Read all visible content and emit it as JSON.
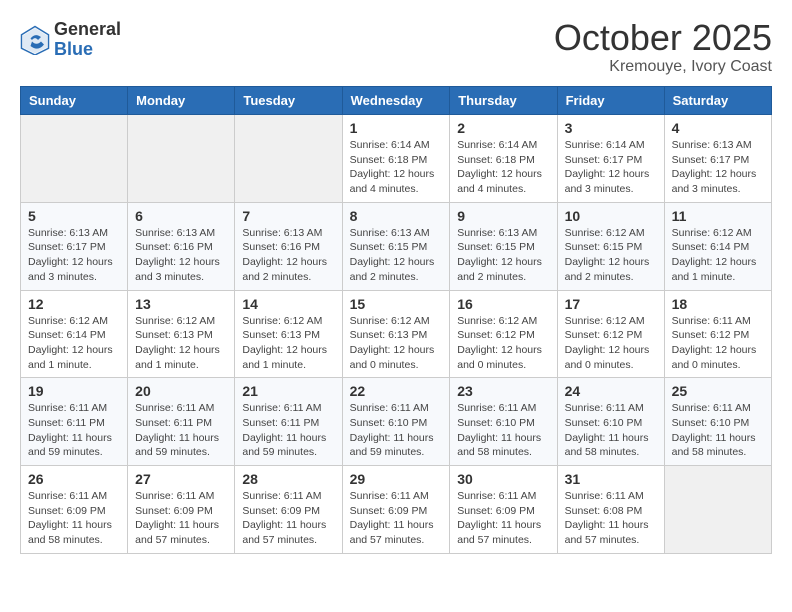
{
  "header": {
    "logo_general": "General",
    "logo_blue": "Blue",
    "month": "October 2025",
    "location": "Kremouye, Ivory Coast"
  },
  "days_of_week": [
    "Sunday",
    "Monday",
    "Tuesday",
    "Wednesday",
    "Thursday",
    "Friday",
    "Saturday"
  ],
  "weeks": [
    [
      {
        "day": "",
        "info": ""
      },
      {
        "day": "",
        "info": ""
      },
      {
        "day": "",
        "info": ""
      },
      {
        "day": "1",
        "info": "Sunrise: 6:14 AM\nSunset: 6:18 PM\nDaylight: 12 hours\nand 4 minutes."
      },
      {
        "day": "2",
        "info": "Sunrise: 6:14 AM\nSunset: 6:18 PM\nDaylight: 12 hours\nand 4 minutes."
      },
      {
        "day": "3",
        "info": "Sunrise: 6:14 AM\nSunset: 6:17 PM\nDaylight: 12 hours\nand 3 minutes."
      },
      {
        "day": "4",
        "info": "Sunrise: 6:13 AM\nSunset: 6:17 PM\nDaylight: 12 hours\nand 3 minutes."
      }
    ],
    [
      {
        "day": "5",
        "info": "Sunrise: 6:13 AM\nSunset: 6:17 PM\nDaylight: 12 hours\nand 3 minutes."
      },
      {
        "day": "6",
        "info": "Sunrise: 6:13 AM\nSunset: 6:16 PM\nDaylight: 12 hours\nand 3 minutes."
      },
      {
        "day": "7",
        "info": "Sunrise: 6:13 AM\nSunset: 6:16 PM\nDaylight: 12 hours\nand 2 minutes."
      },
      {
        "day": "8",
        "info": "Sunrise: 6:13 AM\nSunset: 6:15 PM\nDaylight: 12 hours\nand 2 minutes."
      },
      {
        "day": "9",
        "info": "Sunrise: 6:13 AM\nSunset: 6:15 PM\nDaylight: 12 hours\nand 2 minutes."
      },
      {
        "day": "10",
        "info": "Sunrise: 6:12 AM\nSunset: 6:15 PM\nDaylight: 12 hours\nand 2 minutes."
      },
      {
        "day": "11",
        "info": "Sunrise: 6:12 AM\nSunset: 6:14 PM\nDaylight: 12 hours\nand 1 minute."
      }
    ],
    [
      {
        "day": "12",
        "info": "Sunrise: 6:12 AM\nSunset: 6:14 PM\nDaylight: 12 hours\nand 1 minute."
      },
      {
        "day": "13",
        "info": "Sunrise: 6:12 AM\nSunset: 6:13 PM\nDaylight: 12 hours\nand 1 minute."
      },
      {
        "day": "14",
        "info": "Sunrise: 6:12 AM\nSunset: 6:13 PM\nDaylight: 12 hours\nand 1 minute."
      },
      {
        "day": "15",
        "info": "Sunrise: 6:12 AM\nSunset: 6:13 PM\nDaylight: 12 hours\nand 0 minutes."
      },
      {
        "day": "16",
        "info": "Sunrise: 6:12 AM\nSunset: 6:12 PM\nDaylight: 12 hours\nand 0 minutes."
      },
      {
        "day": "17",
        "info": "Sunrise: 6:12 AM\nSunset: 6:12 PM\nDaylight: 12 hours\nand 0 minutes."
      },
      {
        "day": "18",
        "info": "Sunrise: 6:11 AM\nSunset: 6:12 PM\nDaylight: 12 hours\nand 0 minutes."
      }
    ],
    [
      {
        "day": "19",
        "info": "Sunrise: 6:11 AM\nSunset: 6:11 PM\nDaylight: 11 hours\nand 59 minutes."
      },
      {
        "day": "20",
        "info": "Sunrise: 6:11 AM\nSunset: 6:11 PM\nDaylight: 11 hours\nand 59 minutes."
      },
      {
        "day": "21",
        "info": "Sunrise: 6:11 AM\nSunset: 6:11 PM\nDaylight: 11 hours\nand 59 minutes."
      },
      {
        "day": "22",
        "info": "Sunrise: 6:11 AM\nSunset: 6:10 PM\nDaylight: 11 hours\nand 59 minutes."
      },
      {
        "day": "23",
        "info": "Sunrise: 6:11 AM\nSunset: 6:10 PM\nDaylight: 11 hours\nand 58 minutes."
      },
      {
        "day": "24",
        "info": "Sunrise: 6:11 AM\nSunset: 6:10 PM\nDaylight: 11 hours\nand 58 minutes."
      },
      {
        "day": "25",
        "info": "Sunrise: 6:11 AM\nSunset: 6:10 PM\nDaylight: 11 hours\nand 58 minutes."
      }
    ],
    [
      {
        "day": "26",
        "info": "Sunrise: 6:11 AM\nSunset: 6:09 PM\nDaylight: 11 hours\nand 58 minutes."
      },
      {
        "day": "27",
        "info": "Sunrise: 6:11 AM\nSunset: 6:09 PM\nDaylight: 11 hours\nand 57 minutes."
      },
      {
        "day": "28",
        "info": "Sunrise: 6:11 AM\nSunset: 6:09 PM\nDaylight: 11 hours\nand 57 minutes."
      },
      {
        "day": "29",
        "info": "Sunrise: 6:11 AM\nSunset: 6:09 PM\nDaylight: 11 hours\nand 57 minutes."
      },
      {
        "day": "30",
        "info": "Sunrise: 6:11 AM\nSunset: 6:09 PM\nDaylight: 11 hours\nand 57 minutes."
      },
      {
        "day": "31",
        "info": "Sunrise: 6:11 AM\nSunset: 6:08 PM\nDaylight: 11 hours\nand 57 minutes."
      },
      {
        "day": "",
        "info": ""
      }
    ]
  ]
}
